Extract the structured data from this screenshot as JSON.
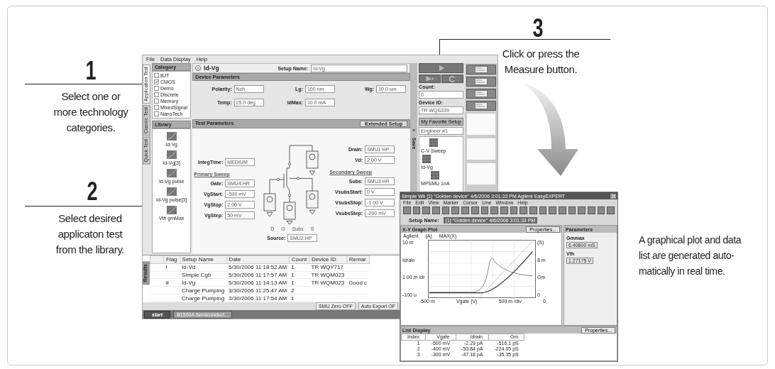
{
  "callouts": [
    {
      "number": "1",
      "lines": [
        "Select one or",
        "more technology",
        "categories."
      ]
    },
    {
      "number": "2",
      "lines": [
        "Select desired",
        "applicaton test",
        "from the library."
      ]
    },
    {
      "number": "3",
      "lines": [
        "Click or press the",
        "Measure button."
      ]
    }
  ],
  "note": {
    "lines": [
      "A graphical plot and data",
      "list are generated auto-",
      "matically in real time."
    ]
  },
  "app": {
    "menu": [
      "File",
      "Data Display",
      "Help"
    ],
    "side_tabs": [
      {
        "label": "Application Test",
        "selected": true
      },
      {
        "label": "Classic Test",
        "selected": false
      },
      {
        "label": "Quick Test",
        "selected": false
      }
    ],
    "category": {
      "title": "Category",
      "items": [
        {
          "label": "BJT",
          "checked": false
        },
        {
          "label": "CMOS",
          "checked": true
        },
        {
          "label": "Demo",
          "checked": false
        },
        {
          "label": "Discrete",
          "checked": false
        },
        {
          "label": "Memory",
          "checked": false
        },
        {
          "label": "MixedSignal",
          "checked": false
        },
        {
          "label": "NanoTech",
          "checked": false
        }
      ]
    },
    "library": {
      "title": "Library",
      "items": [
        "Id-Vg",
        "Id-Vg[3]",
        "Id-Vg pulse",
        "Id-Vg pulse[3]",
        "Vth gmMax"
      ]
    },
    "setup": {
      "title": "Id-Vg",
      "name_label": "Setup Name:",
      "name": "Id-Vg"
    },
    "device_parameters": {
      "title": "Device Parameters",
      "fields": [
        {
          "label": "Polarity:",
          "value": "Nch"
        },
        {
          "label": "Lg:",
          "value": "100 nm"
        },
        {
          "label": "Wg:",
          "value": "10.0 um"
        },
        {
          "label": "Temp:",
          "value": "25.0 deg"
        },
        {
          "label": "IdMax:",
          "value": "10.0 mA"
        }
      ]
    },
    "test_parameters": {
      "title": "Test Parameters",
      "extended": "Extended Setup",
      "integ_time": {
        "label": "IntegTime:",
        "value": "MEDIUM"
      },
      "primary_sweep": {
        "title": "Primary Sweep",
        "fields": [
          {
            "label": "Gate:",
            "value": "SMU4:HR"
          },
          {
            "label": "VgStart:",
            "value": "-500 mV"
          },
          {
            "label": "VgStop:",
            "value": "2.00 V"
          },
          {
            "label": "VgStep:",
            "value": "50 mV"
          }
        ]
      },
      "drain": [
        {
          "label": "Drain:",
          "value": "SMU1:HP"
        },
        {
          "label": "Vd:",
          "value": "2.00 V"
        }
      ],
      "secondary_sweep": {
        "title": "Secondary Sweep",
        "fields": [
          {
            "label": "Subs:",
            "value": "SMU3:HR"
          },
          {
            "label": "VsubsStart:",
            "value": "0 V"
          },
          {
            "label": "VsubsStop:",
            "value": "-1.00 V"
          },
          {
            "label": "VsubsStep:",
            "value": "-200 mV"
          }
        ]
      },
      "source": {
        "label": "Source:",
        "value": "SMU2:HP"
      },
      "terminals": [
        "D",
        "G",
        "Subs",
        "S"
      ]
    },
    "save": {
      "glyph": "»",
      "label": "Save"
    },
    "right_panel": {
      "count_label": "Count:",
      "count": "0",
      "device_id_label": "Device ID:",
      "device_id": "TR WQS339",
      "favorite": "My Favorite Setup",
      "engineer": "Engineer #1",
      "items": [
        "C-V Sweep",
        "Id-Vg",
        "MPSMU 1nA"
      ]
    },
    "results": {
      "tab": "Results",
      "columns": [
        "Flag",
        "Setup Name",
        "Date",
        "Count",
        "Device ID",
        "Remar"
      ],
      "rows": [
        {
          "flag": "!",
          "setup_name": "Id-Vd",
          "date": "5/30/2006 11:18:52 AM",
          "count": "1",
          "device_id": "TR WQY717"
        },
        {
          "setup_name": "Simple Cgb",
          "date": "5/30/2006 11:17:57 AM",
          "count": "1",
          "device_id": "TR WQM023"
        },
        {
          "flag": "#",
          "setup_name": "Id-Vg",
          "date": "5/30/2006 11:14:13 AM",
          "count": "1",
          "device_id": "TR WQM023",
          "remark": "Good c"
        },
        {
          "setup_name": "Charge Pumping",
          "date": "3/30/2006 11:25:47 AM",
          "count": "2"
        },
        {
          "setup_name": "Charge Pumping",
          "date": "3/30/2006 11:17:54 AM",
          "count": "1"
        }
      ]
    },
    "status": [
      "SMU Zero OFF",
      "Auto Export OF"
    ],
    "taskbar": {
      "start": "start",
      "items": [
        "B1500A Semiconduct..."
      ]
    }
  },
  "graph_window": {
    "title": "Simple Wk [1] \"Golden device\" 4/6/2006 3:01:33 PM   Agilent EasyEXPERT",
    "menu": [
      "File",
      "Edit",
      "View",
      "Marker",
      "Cursor",
      "Line",
      "Window",
      "Help"
    ],
    "setup_label": "Setup Name:",
    "setup_name": "[1] \"Golden device\" 4/6/2006 3:01:33 PM",
    "plot": {
      "title": "X-Y Graph Plot",
      "properties": "Properties...",
      "legend": "Agilent",
      "y_unit": "(A)",
      "header": "MAX(X)",
      "y_ticks": [
        "10 m",
        "Idrain",
        "1.00 m Idr",
        "-100 u"
      ],
      "x_ticks": [
        "-500 m",
        "Vgate (V)",
        "500 m /div",
        "0"
      ],
      "y2_ticks": [
        "(S)",
        "8 m",
        "Gm",
        "0"
      ]
    },
    "parameters": {
      "title": "Parameters",
      "items": [
        {
          "label": "Gmmax",
          "value": "6.40800 mS"
        },
        {
          "label": "Vth",
          "value": "1.27175 V"
        }
      ]
    },
    "list": {
      "title": "List Display",
      "properties": "Properties...",
      "columns": [
        "Index",
        "Vgate",
        "Idrain",
        "Gm"
      ],
      "rows": [
        [
          "1",
          "-500 mV",
          "-2.29 pA",
          "-516.1 pS"
        ],
        [
          "2",
          "-400 mV",
          "-53.84 pA",
          "-224.05 pS"
        ],
        [
          "3",
          "-300 mV",
          "-47.18 pA",
          "-35.35 pS"
        ]
      ]
    }
  }
}
